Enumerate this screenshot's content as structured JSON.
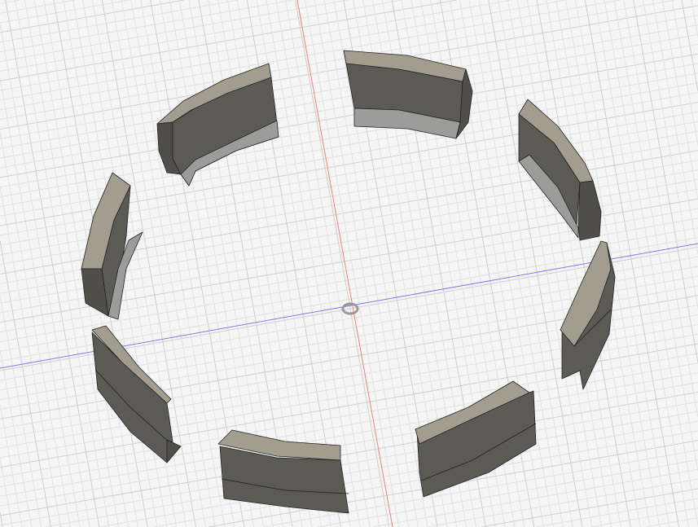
{
  "viewport": {
    "background": "#f5f5f5",
    "grid_minor_color": "#e2e2e2",
    "grid_major_color": "#cfcfcf",
    "x_axis_color": "#7b7bf0",
    "z_axis_color": "#f08080",
    "face_top_color": "#a39d8f",
    "face_front_color": "#5b5a55",
    "face_inner_color": "#9c9c9a"
  }
}
